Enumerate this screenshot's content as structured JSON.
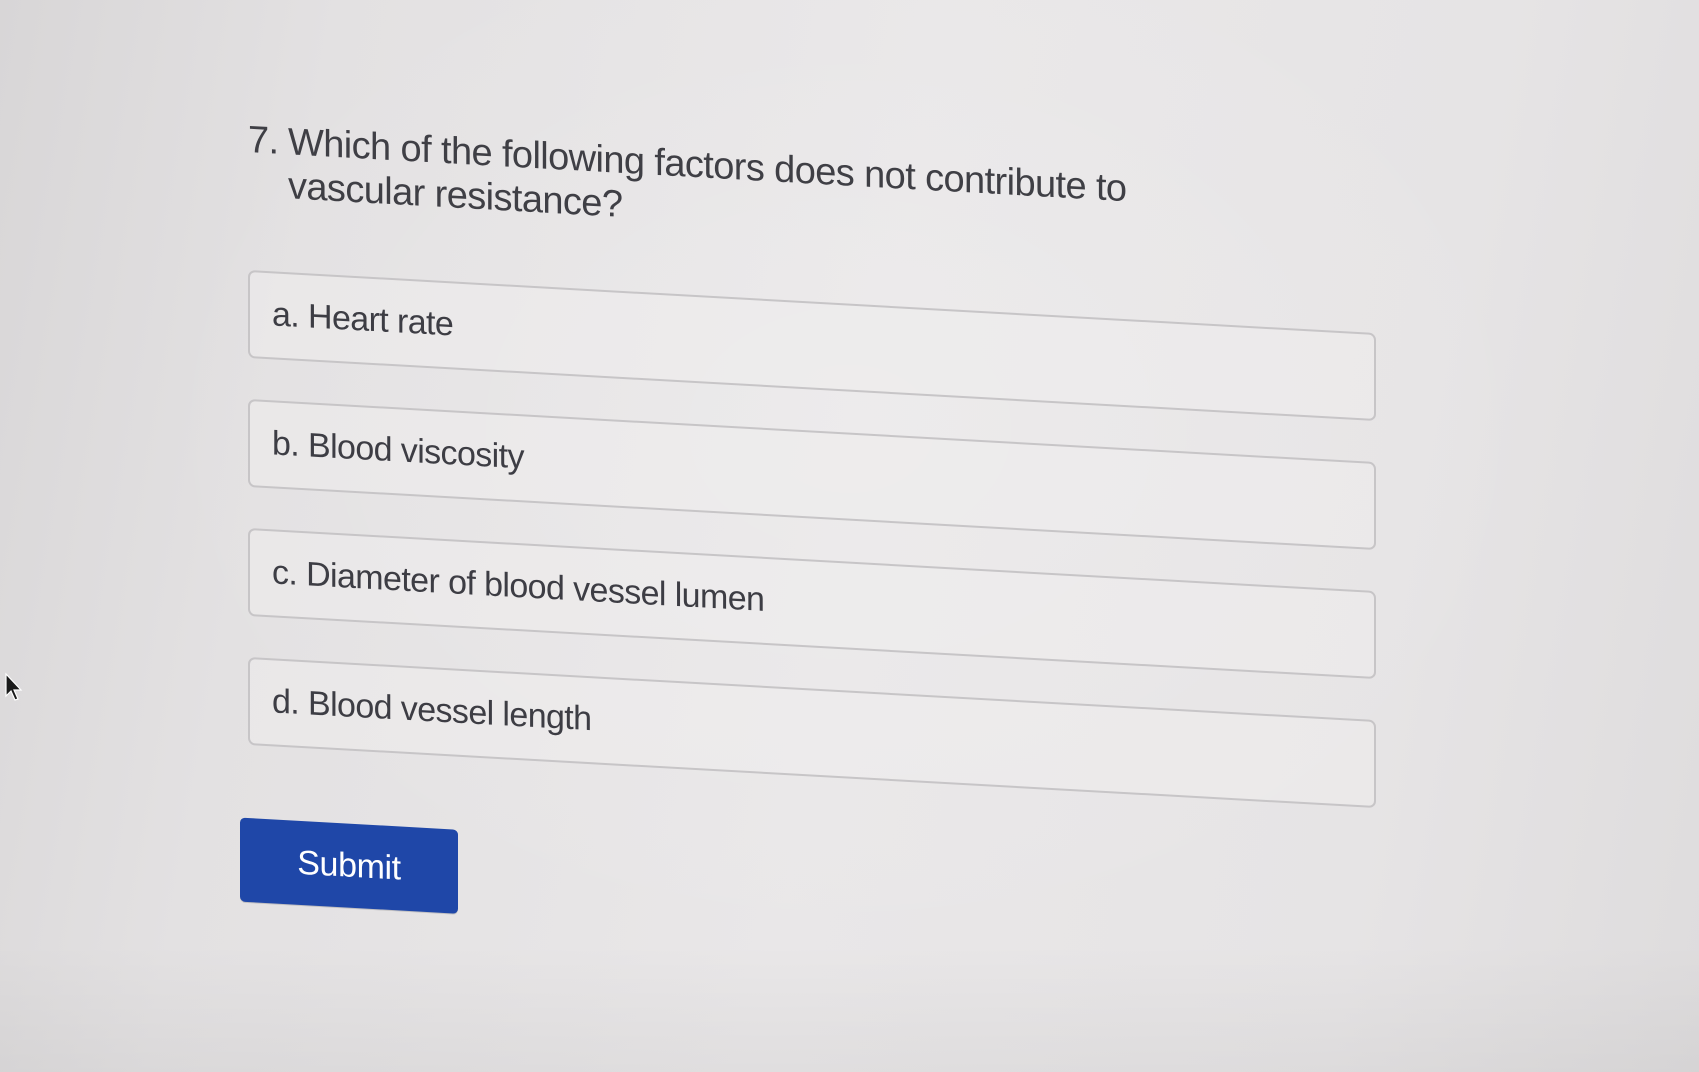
{
  "quiz": {
    "question": {
      "number": "7.",
      "text": "Which of the following factors does not contribute to vascular resistance?"
    },
    "options": [
      {
        "label": "a. Heart rate"
      },
      {
        "label": "b. Blood viscosity"
      },
      {
        "label": "c. Diameter of blood vessel lumen"
      },
      {
        "label": "d. Blood vessel length"
      }
    ],
    "submit_label": "Submit"
  },
  "colors": {
    "background": "#e7e5e6",
    "text": "#3f3f45",
    "option_border": "#c7c5c7",
    "submit_bg": "#1f47a8",
    "submit_text": "#ffffff"
  },
  "icons": {
    "cursor": "mouse-pointer-icon"
  }
}
